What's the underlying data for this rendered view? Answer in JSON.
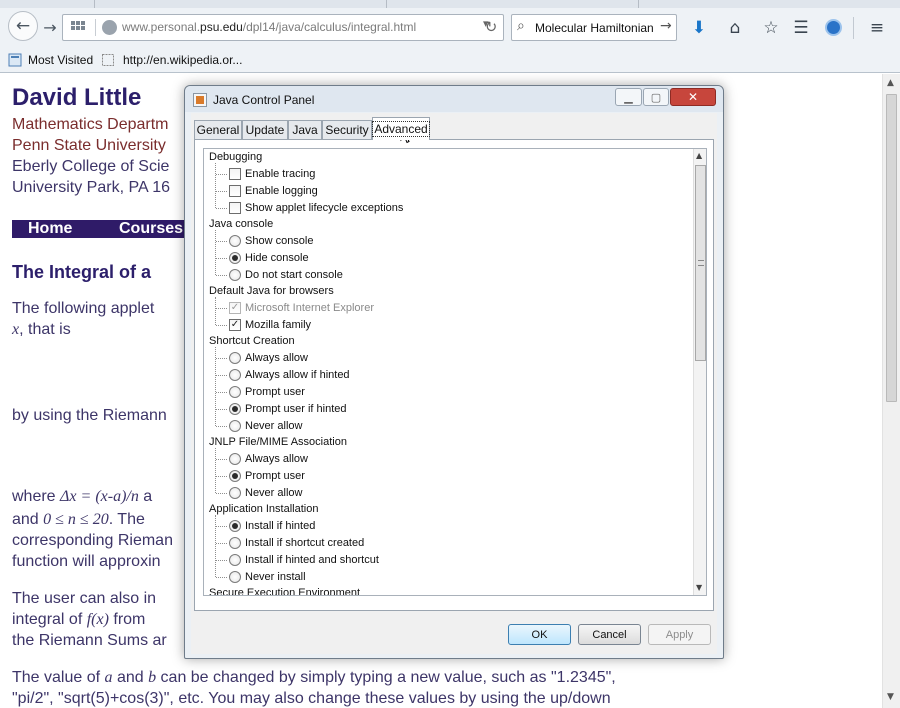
{
  "browser": {
    "url_domain_prefix": "www.personal.",
    "url_domain": "psu.edu",
    "url_path": "/dpl14/java/calculus/integral.html",
    "search_query": "Molecular Hamiltonian",
    "bookmarks": [
      "Most Visited",
      "http://en.wikipedia.or..."
    ]
  },
  "page": {
    "author": "David Little",
    "address_lines": [
      "Mathematics Departm",
      "Penn State University",
      "Eberly College of Scie",
      "University Park, PA 16"
    ],
    "nav": [
      "Home",
      "Courses"
    ],
    "section_title": "The Integral of a",
    "p1a": "The following applet",
    "p1b_var": "x",
    "p1b_rest": ", that is",
    "p2": "by using the Riemann",
    "p3a_pre": "where ",
    "p3a_math": "Δx = (x-a)/n",
    "p3a_post": " a",
    "p3b_pre": "and ",
    "p3b_math": "0 ≤ n ≤ 20",
    "p3b_post": ". The",
    "p3c": "corresponding Rieman",
    "p3d": "function will approxin",
    "p4a": "The user can also in",
    "p4b_pre": "integral of ",
    "p4b_math": "f(x)",
    "p4b_post": " from",
    "p4c": "the Riemann Sums ar",
    "p5a_pre": "The value of ",
    "p5a_a": "a",
    "p5a_mid": " and ",
    "p5a_b": "b",
    "p5a_post": " can be changed by simply typing a new value, such as \"1.2345\",",
    "p5b": "\"pi/2\", \"sqrt(5)+cos(3)\", etc. You may also change these values by using the up/down"
  },
  "dialog": {
    "title": "Java Control Panel",
    "tabs": [
      "General",
      "Update",
      "Java",
      "Security",
      "Advanced"
    ],
    "active_tab": "Advanced",
    "groups": {
      "debugging": "Debugging",
      "java_console": "Java console",
      "default_java": "Default Java for browsers",
      "shortcut": "Shortcut Creation",
      "jnlp": "JNLP File/MIME Association",
      "app_install": "Application Installation",
      "secure_exec": "Secure Execution Environment"
    },
    "options": {
      "enable_tracing": "Enable tracing",
      "enable_logging": "Enable logging",
      "show_applet_lifecycle": "Show applet lifecycle exceptions",
      "show_console": "Show console",
      "hide_console": "Hide console",
      "do_not_start_console": "Do not start console",
      "ms_ie": "Microsoft Internet Explorer",
      "mozilla": "Mozilla family",
      "sc_always": "Always allow",
      "sc_always_hinted": "Always allow if hinted",
      "sc_prompt": "Prompt user",
      "sc_prompt_hinted": "Prompt user if hinted",
      "sc_never": "Never allow",
      "jnlp_always": "Always allow",
      "jnlp_prompt": "Prompt user",
      "jnlp_never": "Never allow",
      "ai_hinted": "Install if hinted",
      "ai_shortcut": "Install if shortcut created",
      "ai_hinted_shortcut": "Install if hinted and shortcut",
      "ai_never": "Never install"
    },
    "selected": {
      "java_console": "Hide console",
      "shortcut": "Prompt user if hinted",
      "jnlp": "Prompt user",
      "app_install": "Install if hinted"
    },
    "checked": {
      "ms_ie": true,
      "mozilla": true
    },
    "buttons": {
      "ok": "OK",
      "cancel": "Cancel",
      "apply": "Apply"
    }
  }
}
